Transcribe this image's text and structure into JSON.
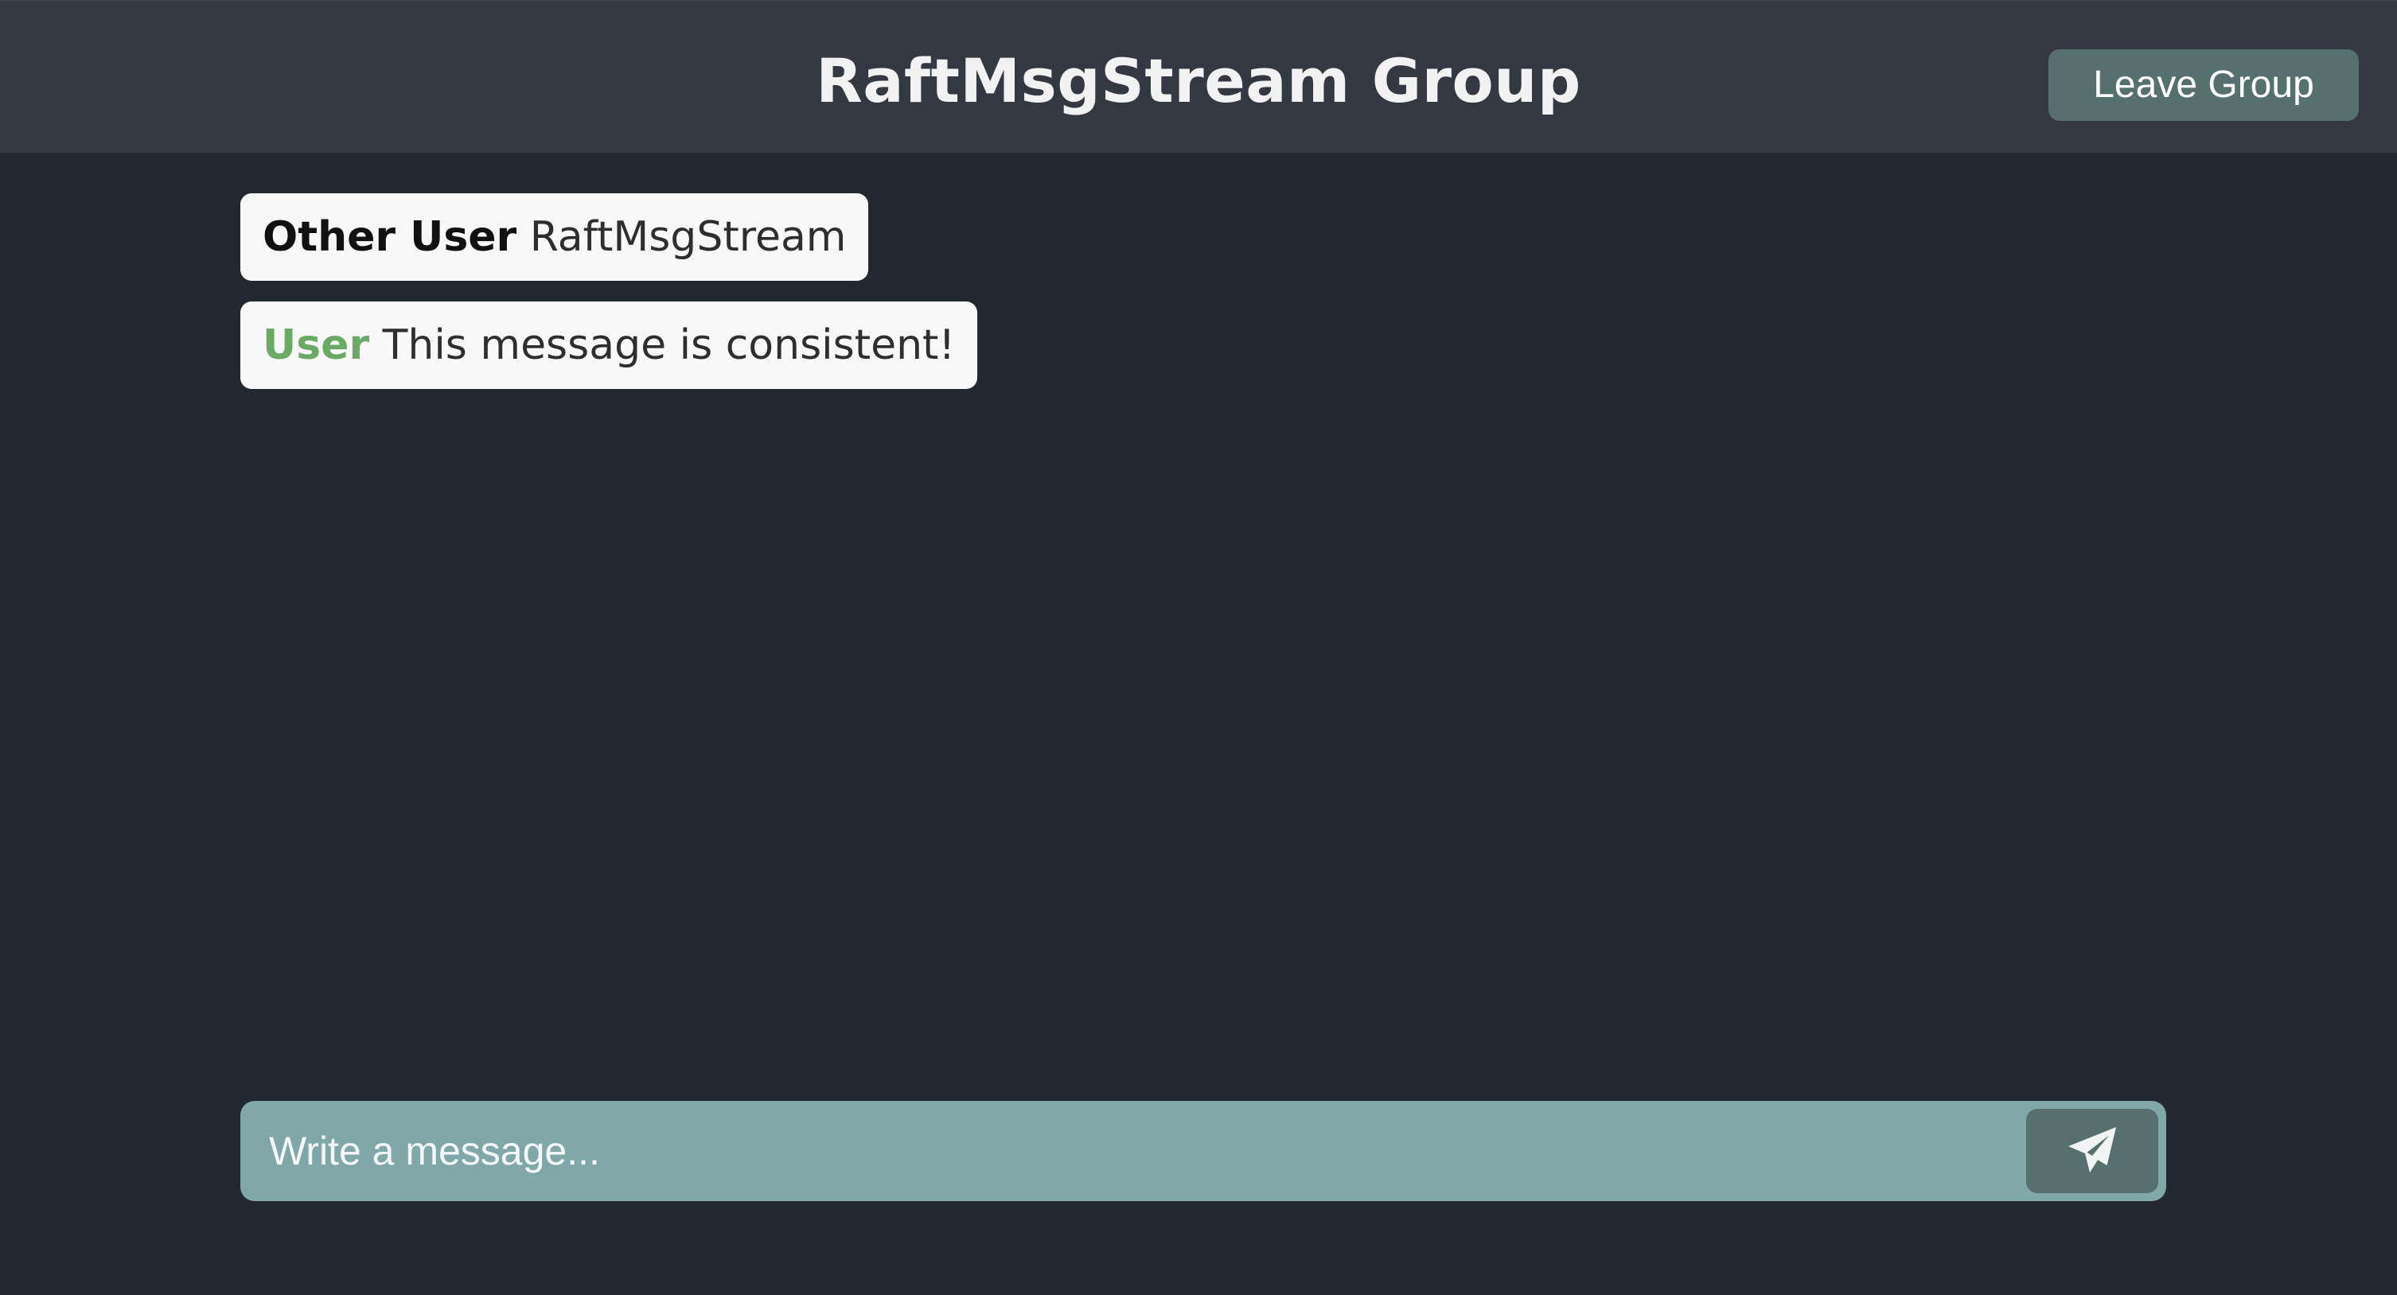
{
  "header": {
    "title": "RaftMsgStream Group",
    "leave_label": "Leave Group"
  },
  "messages": [
    {
      "sender": "Other User",
      "text": "RaftMsgStream",
      "is_self": false
    },
    {
      "sender": "User",
      "text": "This message is consistent!",
      "is_self": true
    }
  ],
  "composer": {
    "placeholder": "Write a message...",
    "value": "",
    "send_icon": "paper-plane-icon"
  },
  "colors": {
    "background": "#232730",
    "header": "#333842",
    "button": "#56706e",
    "composer": "#81a8a9",
    "self_sender": "#6aaa64"
  }
}
